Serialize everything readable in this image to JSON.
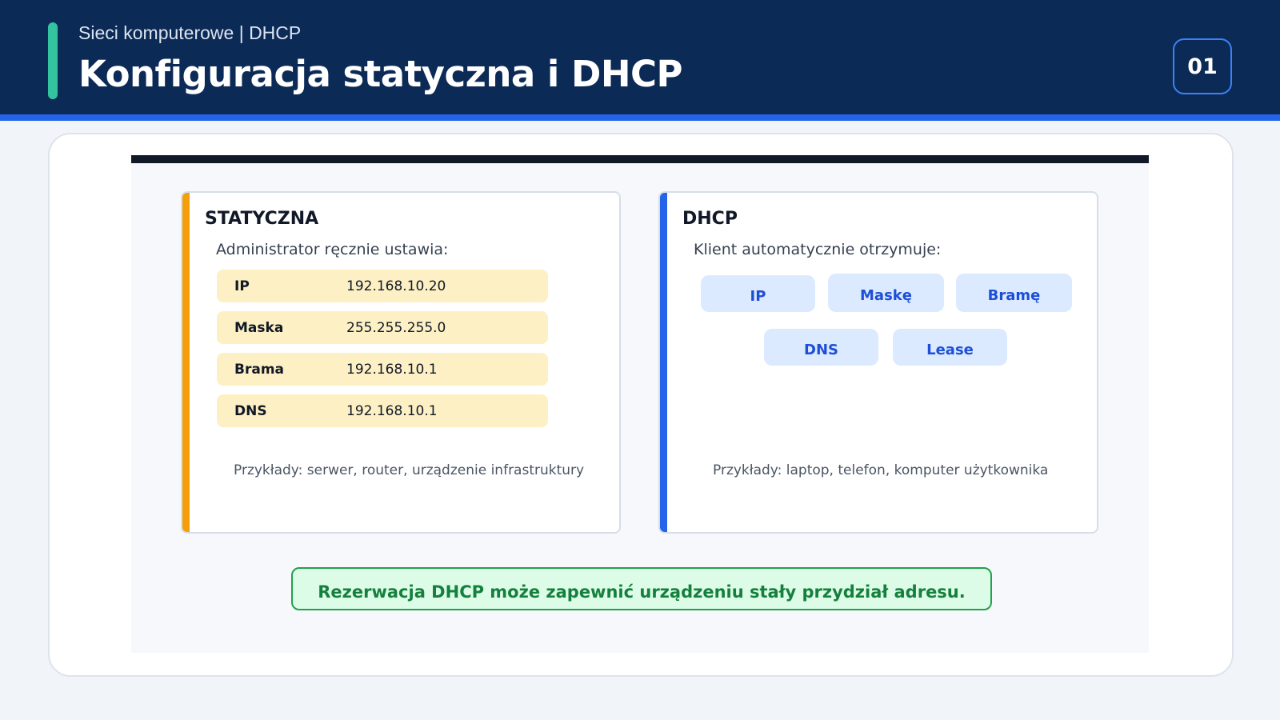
{
  "header": {
    "subtitle": "Sieci komputerowe | DHCP",
    "title": "Konfiguracja statyczna i DHCP",
    "slide_number": "01"
  },
  "colors": {
    "header_bg": "#0c2a56",
    "header_stripe": "#2563eb",
    "accent": "#34c3a0",
    "static_accent": "#f59e0b",
    "dhcp_accent": "#2563eb",
    "note_text": "#15803d"
  },
  "diagram": {
    "static_panel": {
      "title": "STATYCZNA",
      "intro": "Administrator ręcznie ustawia:",
      "rows": [
        {
          "key": "IP",
          "value": "192.168.10.20"
        },
        {
          "key": "Maska",
          "value": "255.255.255.0"
        },
        {
          "key": "Brama",
          "value": "192.168.10.1"
        },
        {
          "key": "DNS",
          "value": "192.168.10.1"
        }
      ],
      "examples": "Przykłady: serwer, router, urządzenie infrastruktury"
    },
    "dhcp_panel": {
      "title": "DHCP",
      "intro": "Klient automatycznie otrzymuje:",
      "items": [
        "IP",
        "Maskę",
        "Bramę",
        "DNS",
        "Lease"
      ],
      "examples": "Przykłady: laptop, telefon, komputer użytkownika"
    },
    "note": "Rezerwacja DHCP może zapewnić urządzeniu stały przydział adresu."
  }
}
